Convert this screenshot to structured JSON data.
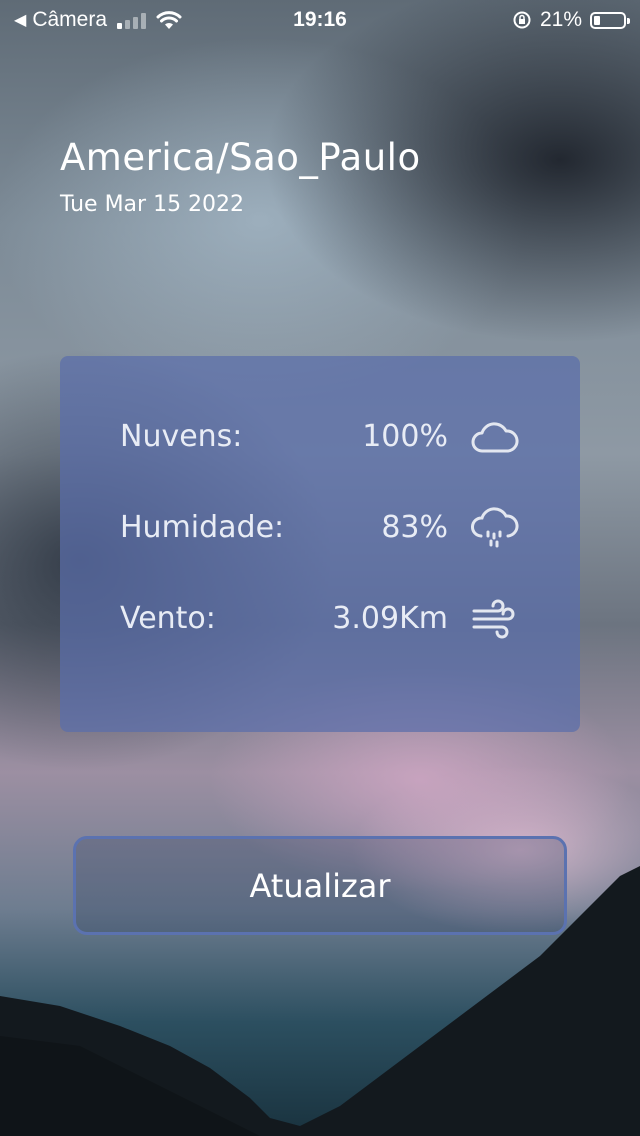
{
  "status_bar": {
    "back_label": "Câmera",
    "time": "19:16",
    "battery": "21%",
    "battery_level": 0.21
  },
  "location": {
    "city": "America/Sao_Paulo",
    "date": "Tue Mar 15 2022"
  },
  "weather": {
    "rows": [
      {
        "label": "Nuvens:",
        "value": "100%",
        "icon": "cloud-icon"
      },
      {
        "label": "Humidade:",
        "value": "83%",
        "icon": "cloud-rain-icon"
      },
      {
        "label": "Vento:",
        "value": "3.09Km",
        "icon": "wind-icon"
      }
    ]
  },
  "actions": {
    "refresh_label": "Atualizar"
  },
  "colors": {
    "card": "#5a6eaa",
    "button_border": "#5b72b0"
  }
}
